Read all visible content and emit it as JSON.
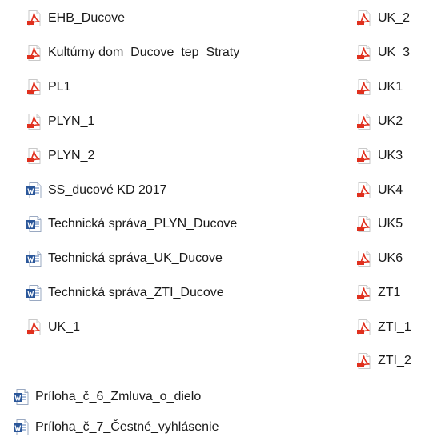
{
  "colors": {
    "pdf_icon": "#e0301e",
    "word_icon": "#2b579a",
    "text": "#1a1a1a"
  },
  "col1": [
    {
      "name": "EHB_Ducove",
      "icon": "pdf-icon"
    },
    {
      "name": "Kultúrny dom_Ducove_tep_Straty",
      "icon": "pdf-icon"
    },
    {
      "name": "PL1",
      "icon": "pdf-icon"
    },
    {
      "name": "PLYN_1",
      "icon": "pdf-icon"
    },
    {
      "name": "PLYN_2",
      "icon": "pdf-icon"
    },
    {
      "name": "SS_ducové KD 2017",
      "icon": "word-icon"
    },
    {
      "name": "Technická správa_PLYN_Ducove",
      "icon": "word-icon"
    },
    {
      "name": "Technická správa_UK_Ducove",
      "icon": "word-icon"
    },
    {
      "name": "Technická správa_ZTI_Ducove",
      "icon": "word-icon"
    },
    {
      "name": "UK_1",
      "icon": "pdf-icon"
    }
  ],
  "col2": [
    {
      "name": "UK_2",
      "icon": "pdf-icon"
    },
    {
      "name": "UK_3",
      "icon": "pdf-icon"
    },
    {
      "name": "UK1",
      "icon": "pdf-icon"
    },
    {
      "name": "UK2",
      "icon": "pdf-icon"
    },
    {
      "name": "UK3",
      "icon": "pdf-icon"
    },
    {
      "name": "UK4",
      "icon": "pdf-icon"
    },
    {
      "name": "UK5",
      "icon": "pdf-icon"
    },
    {
      "name": "UK6",
      "icon": "pdf-icon"
    },
    {
      "name": "ZT1",
      "icon": "pdf-icon"
    },
    {
      "name": "ZTI_1",
      "icon": "pdf-icon"
    },
    {
      "name": "ZTI_2",
      "icon": "pdf-icon"
    }
  ],
  "bottom": [
    {
      "name": "Príloha_č_6_Zmluva_o_dielo",
      "icon": "word-icon"
    },
    {
      "name": "Príloha_č_7_Čestné_vyhlásenie",
      "icon": "word-icon"
    }
  ]
}
